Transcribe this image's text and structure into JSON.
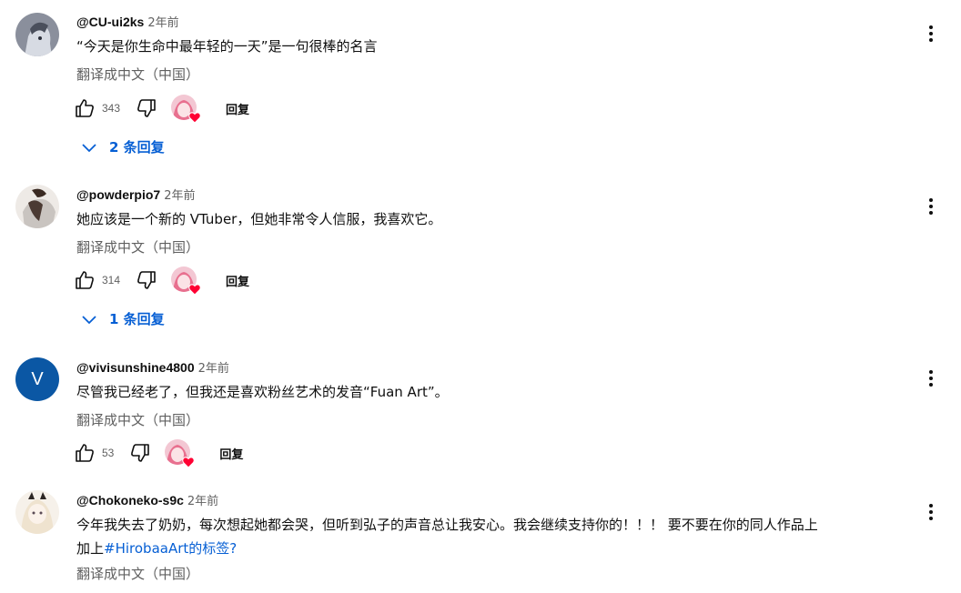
{
  "labels": {
    "translate": "翻译成中文（中国）",
    "reply": "回复"
  },
  "comments": [
    {
      "author": "@CU-ui2ks",
      "time": "2年前",
      "text": "“今天是你生命中最年轻的一天”是一句很棒的名言",
      "likes": "343",
      "replies_label": "2 条回复"
    },
    {
      "author": "@powderpio7",
      "time": "2年前",
      "text": "她应该是一个新的 VTuber，但她非常令人信服，我喜欢它。",
      "likes": "314",
      "replies_label": "1 条回复"
    },
    {
      "author": "@vivisunshine4800",
      "time": "2年前",
      "avatar_letter": "V",
      "text": "尽管我已经老了，但我还是喜欢粉丝艺术的发音“Fuan Art”。",
      "likes": "53"
    },
    {
      "author": "@Chokoneko-s9c",
      "time": "2年前",
      "text_line1": "今年我失去了奶奶，每次想起她都会哭，但听到弘子的声音总让我安心。我会继续支持你的！！！ 要不要在你的同人作品上",
      "text_line2_prefix": "加上",
      "hashtag": "#HirobaaArt的标签?"
    }
  ],
  "colors": {
    "link": "#065fd4",
    "secondary_text": "#606060",
    "avatar_v": "#0b57a4",
    "heart": "#ff0033"
  },
  "icons": [
    "thumb-up-icon",
    "thumb-down-icon",
    "heart-icon",
    "chevron-down-icon",
    "more-vert-icon"
  ]
}
